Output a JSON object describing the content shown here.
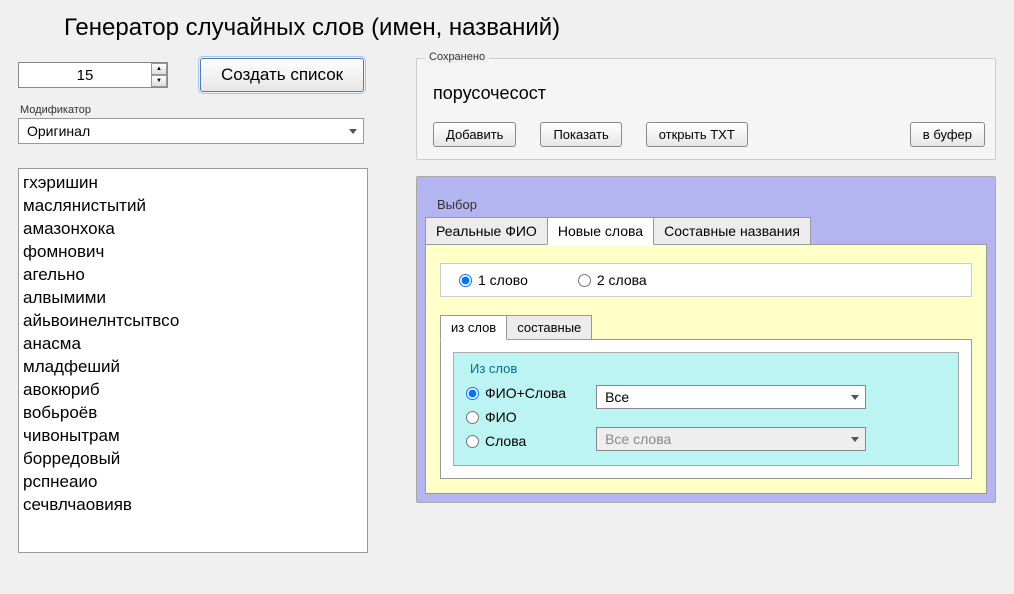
{
  "title": "Генератор случайных слов (имен, названий)",
  "controls": {
    "count": "15",
    "create_btn": "Создать список",
    "modifier_label": "Модификатор",
    "modifier_value": "Оригинал"
  },
  "words": [
    "гхэришин",
    "маслянистытий",
    "амазонхока",
    "фомнович",
    "агельно",
    "алвымими",
    "айьвоинелнтсытвсо",
    "анасма",
    "младфеший",
    "авокюриб",
    "вобьроёв",
    "чивонытрам",
    "борредовый",
    "рспнеаио",
    "сечвлчаовияв"
  ],
  "saved": {
    "group_label": "Сохранено",
    "current": "порусочесост",
    "add": "Добавить",
    "show": "Показать",
    "open_txt": "открыть TXT",
    "to_buffer": "в буфер"
  },
  "choice": {
    "group_label": "Выбор",
    "tabs": {
      "real": "Реальные ФИО",
      "new": "Новые слова",
      "compound": "Составные названия"
    },
    "word_count": {
      "one": "1 слово",
      "two": "2 слова"
    },
    "subtabs": {
      "from_words": "из слов",
      "compound": "составные"
    },
    "from_words": {
      "group_label": "Из слов",
      "opt_fio_words": "ФИО+Слова",
      "opt_fio": "ФИО",
      "opt_words": "Слова",
      "select1": "Все",
      "select2": "Все слова"
    }
  }
}
